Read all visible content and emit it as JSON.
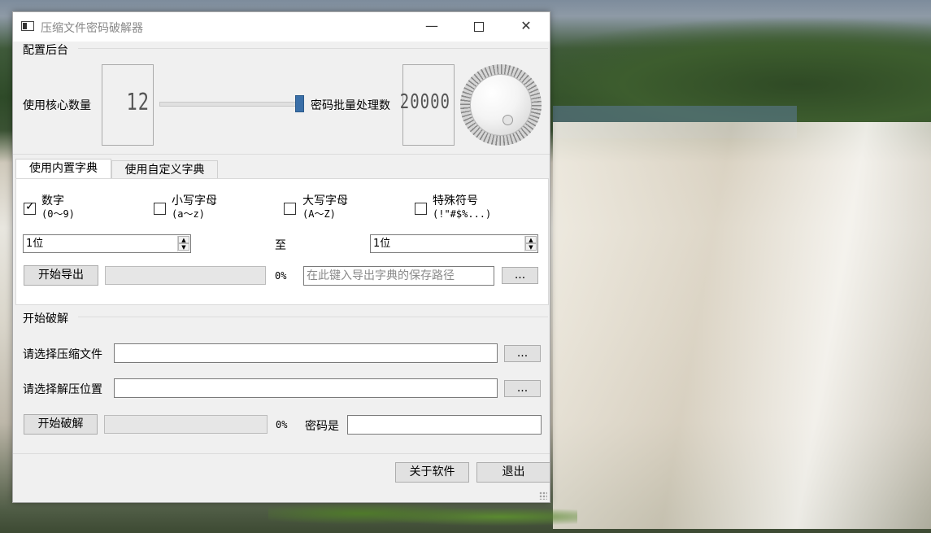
{
  "window": {
    "title": "压缩文件密码破解器",
    "controls": {
      "minimize": "—",
      "close": "✕"
    }
  },
  "config": {
    "group_title": "配置后台",
    "cores_label": "使用核心数量",
    "cores_value": "12",
    "batch_label": "密码批量处理数",
    "batch_value": "20000"
  },
  "tabs": [
    {
      "label": "使用内置字典",
      "active": true
    },
    {
      "label": "使用自定义字典",
      "active": false
    }
  ],
  "charsets": [
    {
      "label": "数字",
      "sub": "(0～9)",
      "checked": true
    },
    {
      "label": "小写字母",
      "sub": "(a～z)",
      "checked": false
    },
    {
      "label": "大写字母",
      "sub": "(A～Z)",
      "checked": false
    },
    {
      "label": "特殊符号",
      "sub": "(!\"#$%...)",
      "checked": false
    }
  ],
  "length": {
    "min": "1位",
    "to": "至",
    "max": "1位"
  },
  "export": {
    "button": "开始导出",
    "percent": "0%",
    "path_placeholder": "在此键入导出字典的保存路径",
    "browse": "..."
  },
  "crack": {
    "group_title": "开始破解",
    "archive_label": "请选择压缩文件",
    "archive_value": "",
    "archive_browse": "...",
    "extract_label": "请选择解压位置",
    "extract_value": "",
    "extract_browse": "...",
    "start_button": "开始破解",
    "percent": "0%",
    "password_label": "密码是",
    "password_value": ""
  },
  "footer": {
    "about": "关于软件",
    "exit": "退出"
  }
}
